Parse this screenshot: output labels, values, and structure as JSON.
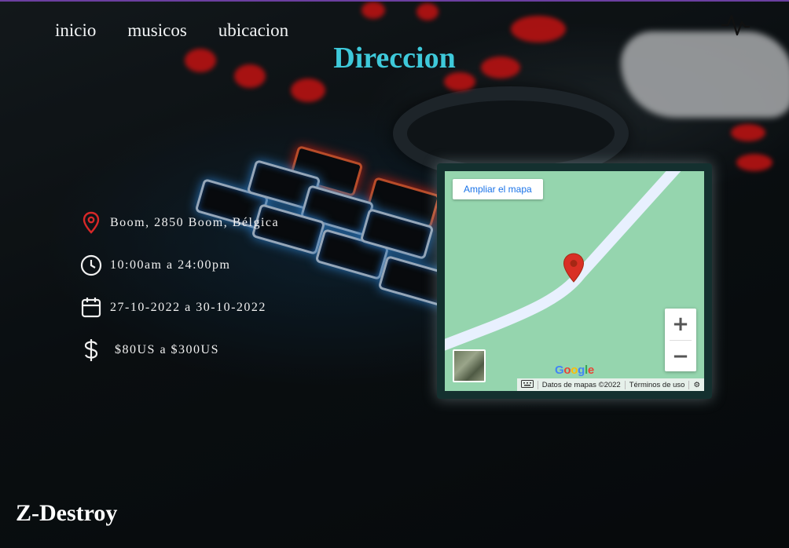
{
  "nav": {
    "items": [
      "inicio",
      "musicos",
      "ubicacion"
    ]
  },
  "header": {
    "icon": "activity-pulse-icon"
  },
  "page": {
    "title": "Direccion"
  },
  "info": {
    "address": "Boom, 2850 Boom, Bélgica",
    "hours": "10:00am a 24:00pm",
    "dates": "27-10-2022 a 30-10-2022",
    "price": "$80US a $300US"
  },
  "map": {
    "enlarge_label": "Ampliar el mapa",
    "zoom_in": "+",
    "zoom_out": "−",
    "logo": [
      "G",
      "o",
      "o",
      "g",
      "l",
      "e"
    ],
    "logo_colors": [
      "#4285F4",
      "#EA4335",
      "#FBBC05",
      "#4285F4",
      "#34A853",
      "#EA4335"
    ],
    "map_data": "Datos de mapas ©2022",
    "terms": "Términos de uso",
    "pin_color": "#d93025",
    "road_color": "#e8f0fe"
  },
  "footer": {
    "brand": "Z-Destroy"
  },
  "colors": {
    "title": "#3ec9da",
    "icon": "#d62828"
  }
}
